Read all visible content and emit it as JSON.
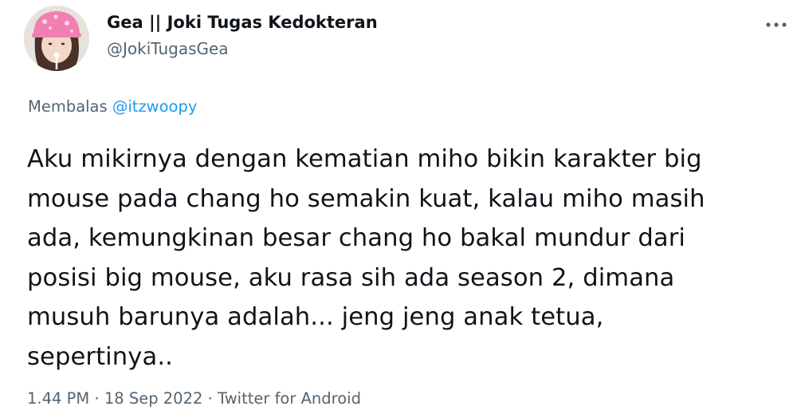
{
  "author": {
    "display_name": "Gea || Joki Tugas Kedokteran",
    "handle": "@JokiTugasGea"
  },
  "reply": {
    "prefix": "Membalas",
    "mention": "@itzwoopy"
  },
  "tweet": {
    "lines": [
      "Aku mikirnya dengan kematian miho bikin karakter big",
      "mouse pada chang ho semakin kuat, kalau miho masih",
      "ada, kemungkinan besar chang ho bakal mundur dari",
      "posisi big mouse, aku rasa sih ada season 2, dimana",
      "musuh barunya adalah... jeng jeng anak tetua,",
      "sepertinya.."
    ]
  },
  "meta": {
    "time": "1.44 PM",
    "separator": " · ",
    "date": "18 Sep 2022",
    "source": "Twitter for Android"
  },
  "icons": {
    "more": "more-options-icon",
    "avatar": "profile-avatar"
  },
  "colors": {
    "text_primary": "#0f1419",
    "text_secondary": "#536471",
    "link": "#1d9bf0"
  }
}
